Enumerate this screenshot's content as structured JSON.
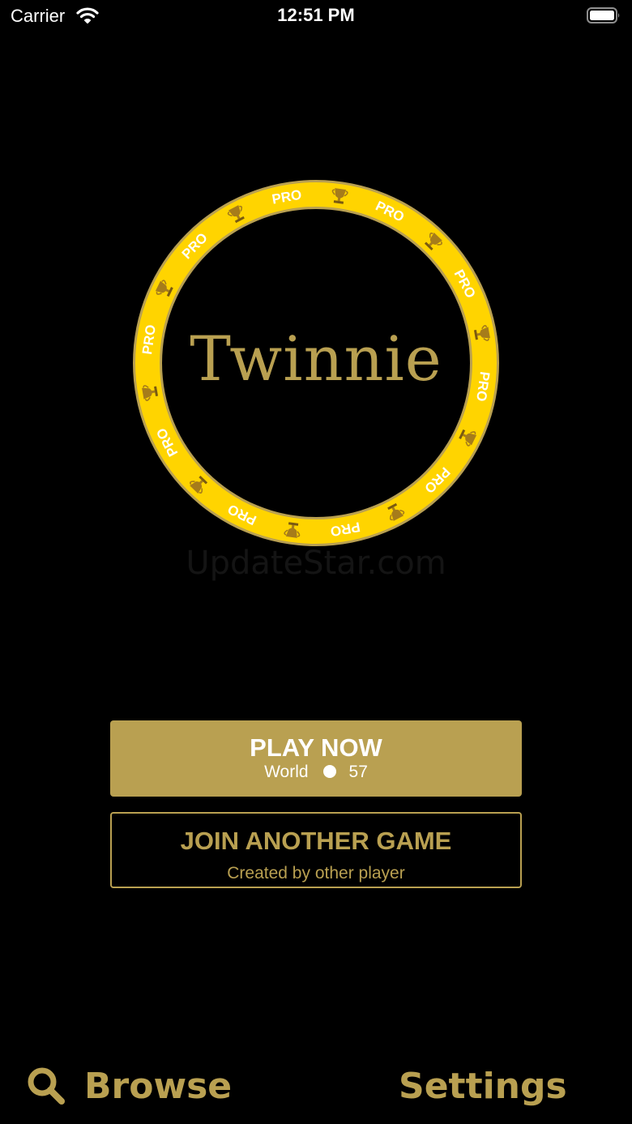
{
  "status_bar": {
    "carrier": "Carrier",
    "time": "12:51 PM"
  },
  "logo": {
    "title": "Twinnie",
    "ring_badge": "PRO",
    "ring_color": "#ffd400",
    "accent": "#b9a051"
  },
  "watermark": "UpdateStar.com",
  "play_button": {
    "label": "PLAY NOW",
    "mode": "World",
    "count": "57"
  },
  "join_button": {
    "label": "JOIN ANOTHER GAME",
    "subtitle": "Created by other player"
  },
  "bottom_nav": {
    "browse": "Browse",
    "settings": "Settings"
  }
}
